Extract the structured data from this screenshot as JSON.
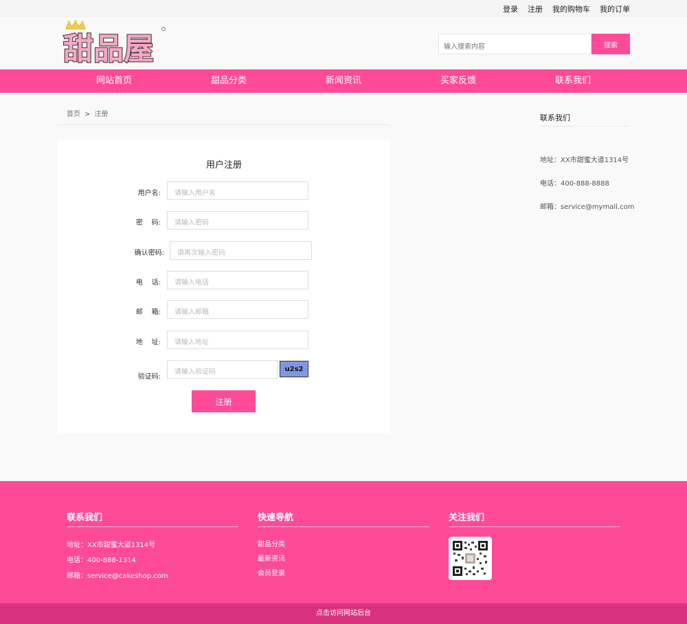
{
  "topbar": {
    "links": [
      "登录",
      "注册",
      "我的购物车",
      "我的订单"
    ]
  },
  "header": {
    "logo_text": "甜品屋"
  },
  "search": {
    "placeholder": "输入搜索内容",
    "button": "搜索"
  },
  "nav": {
    "items": [
      "网站首页",
      "甜品分类",
      "新闻资讯",
      "买家反馈",
      "联系我们"
    ]
  },
  "breadcrumb": {
    "home": "首页",
    "separator": ">",
    "current": "注册"
  },
  "register": {
    "title": "用户注册",
    "fields": [
      {
        "label": "用户名:",
        "placeholder": "请输入用户名"
      },
      {
        "label": "密    码:",
        "placeholder": "请输入密码"
      },
      {
        "label": "确认密码:",
        "placeholder": "请再次输入密码"
      },
      {
        "label": "电    话:",
        "placeholder": "请输入电话"
      },
      {
        "label": "邮    箱:",
        "placeholder": "请输入邮箱"
      },
      {
        "label": "地    址:",
        "placeholder": "请输入地址"
      },
      {
        "label": "验证码:",
        "placeholder": "请输入验证码"
      }
    ],
    "captcha": "u2s2",
    "submit": "注册"
  },
  "sidebar": {
    "title": "联系我们",
    "address": "地址：XX市甜蜜大道1314号",
    "phone": "电话：400-888-8888",
    "email": "邮箱：service@mymall.com"
  },
  "footer": {
    "contact": {
      "title": "联系我们",
      "address": "地址：XX市甜蜜大道1314号",
      "phone": "电话：400-888-1314",
      "email": "邮箱：service@cakeshop.com"
    },
    "quicknav": {
      "title": "快速导航",
      "links": [
        "甜品分类",
        "最新资讯",
        "会员登录"
      ]
    },
    "follow": {
      "title": "关注我们"
    },
    "admin_link": "点击访问网站后台"
  },
  "colors": {
    "brand": "#ff4a98",
    "bottom_bar": "#d8327f"
  }
}
